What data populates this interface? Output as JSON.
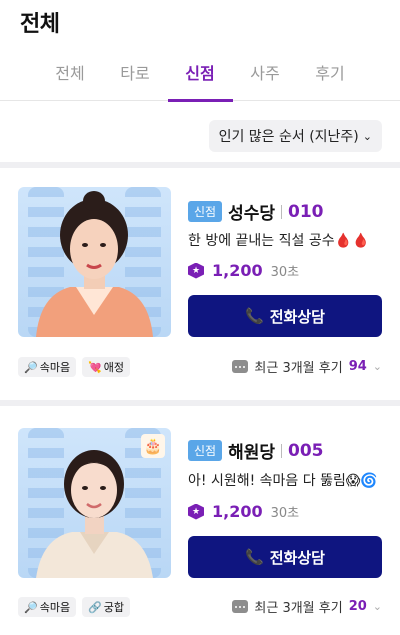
{
  "header": {
    "title": "전체"
  },
  "tabs": [
    {
      "label": "전체",
      "active": false
    },
    {
      "label": "타로",
      "active": false
    },
    {
      "label": "신점",
      "active": true
    },
    {
      "label": "사주",
      "active": false
    },
    {
      "label": "후기",
      "active": false
    }
  ],
  "sort": {
    "label": "인기 많은 순서 (지난주)",
    "icon": "chevron-down-icon"
  },
  "counselors": [
    {
      "badge": "신점",
      "name": "성수당",
      "code": "010",
      "tagline": "한 방에 끝내는 직설 공수🩸🩸",
      "price": "1,200",
      "unit": "30초",
      "call_label": "전화상담",
      "tags": [
        {
          "icon": "🔎",
          "label": "속마음"
        },
        {
          "icon": "💘",
          "label": "애정"
        }
      ],
      "review_label": "최근 3개월 후기",
      "review_count": "94"
    },
    {
      "badge": "신점",
      "name": "해원당",
      "code": "005",
      "tagline": "아! 시원해! 속마음 다 뚫림😱🌀",
      "price": "1,200",
      "unit": "30초",
      "call_label": "전화상담",
      "tags": [
        {
          "icon": "🔎",
          "label": "속마음"
        },
        {
          "icon": "🔗",
          "label": "궁합"
        }
      ],
      "review_label": "최근 3개월 후기",
      "review_count": "20",
      "photo_badge_icon": "🎂"
    }
  ],
  "colors": {
    "accent": "#7a1fb5",
    "call_button": "#0f1580",
    "badge": "#5aa6e8"
  }
}
